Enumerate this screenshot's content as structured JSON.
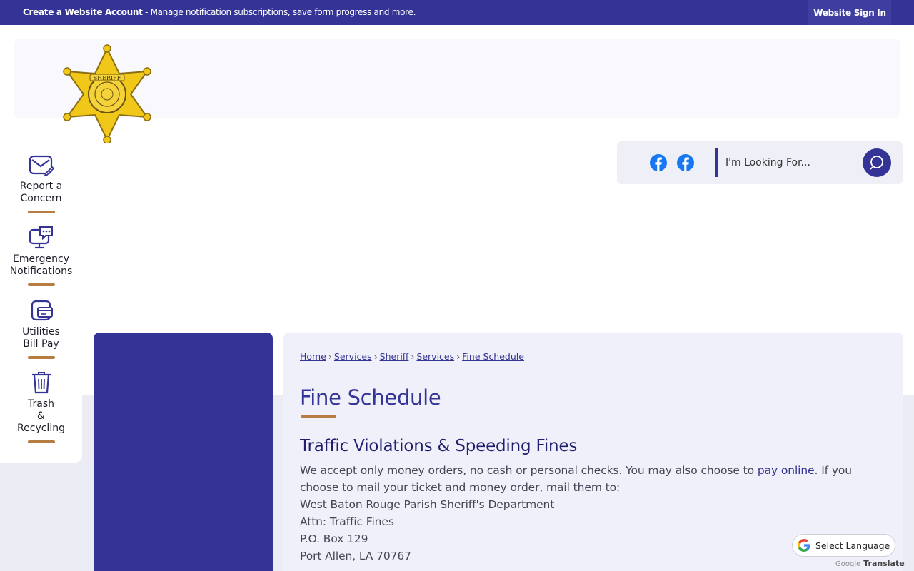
{
  "topbar": {
    "promo_bold": "Create a Website Account",
    "promo_text": " - Manage notification subscriptions, save form progress and more.",
    "signin_label": "Website Sign In"
  },
  "logo": {
    "text_top": "SHERIFF"
  },
  "quick_links": [
    {
      "label_lines": [
        "Report a",
        "Concern"
      ],
      "icon": "envelope-edit-icon"
    },
    {
      "label_lines": [
        "Emergency",
        "Notifications"
      ],
      "icon": "monitor-chat-icon"
    },
    {
      "label_lines": [
        "Utilities",
        "Bill Pay"
      ],
      "icon": "credit-card-icon"
    },
    {
      "label_lines": [
        "Trash",
        "&",
        "Recycling"
      ],
      "icon": "trash-icon"
    }
  ],
  "search": {
    "placeholder": "I'm Looking For...",
    "social": [
      "facebook-icon",
      "facebook-icon"
    ]
  },
  "breadcrumb": [
    "Home",
    "Services",
    "Sheriff",
    "Services",
    "Fine Schedule"
  ],
  "page": {
    "title": "Fine Schedule",
    "section_title": "Traffic Violations & Speeding Fines",
    "para_before_link": "We accept only money orders, no cash or personal checks. You may also choose to ",
    "link_text": "pay online",
    "para_after_link": ". If you choose to mail your ticket and money order, mail them to:",
    "address": [
      "West Baton Rouge Parish Sheriff's Department",
      "Attn: Traffic Fines",
      "P.O. Box 129",
      "Port Allen, LA 70767"
    ]
  },
  "translate": {
    "label": "Select Language",
    "powered_google": "Google",
    "powered_translate": "Translate"
  },
  "colors": {
    "primary": "#343496",
    "accent": "#b67c42",
    "facebook": "#1877f2"
  }
}
